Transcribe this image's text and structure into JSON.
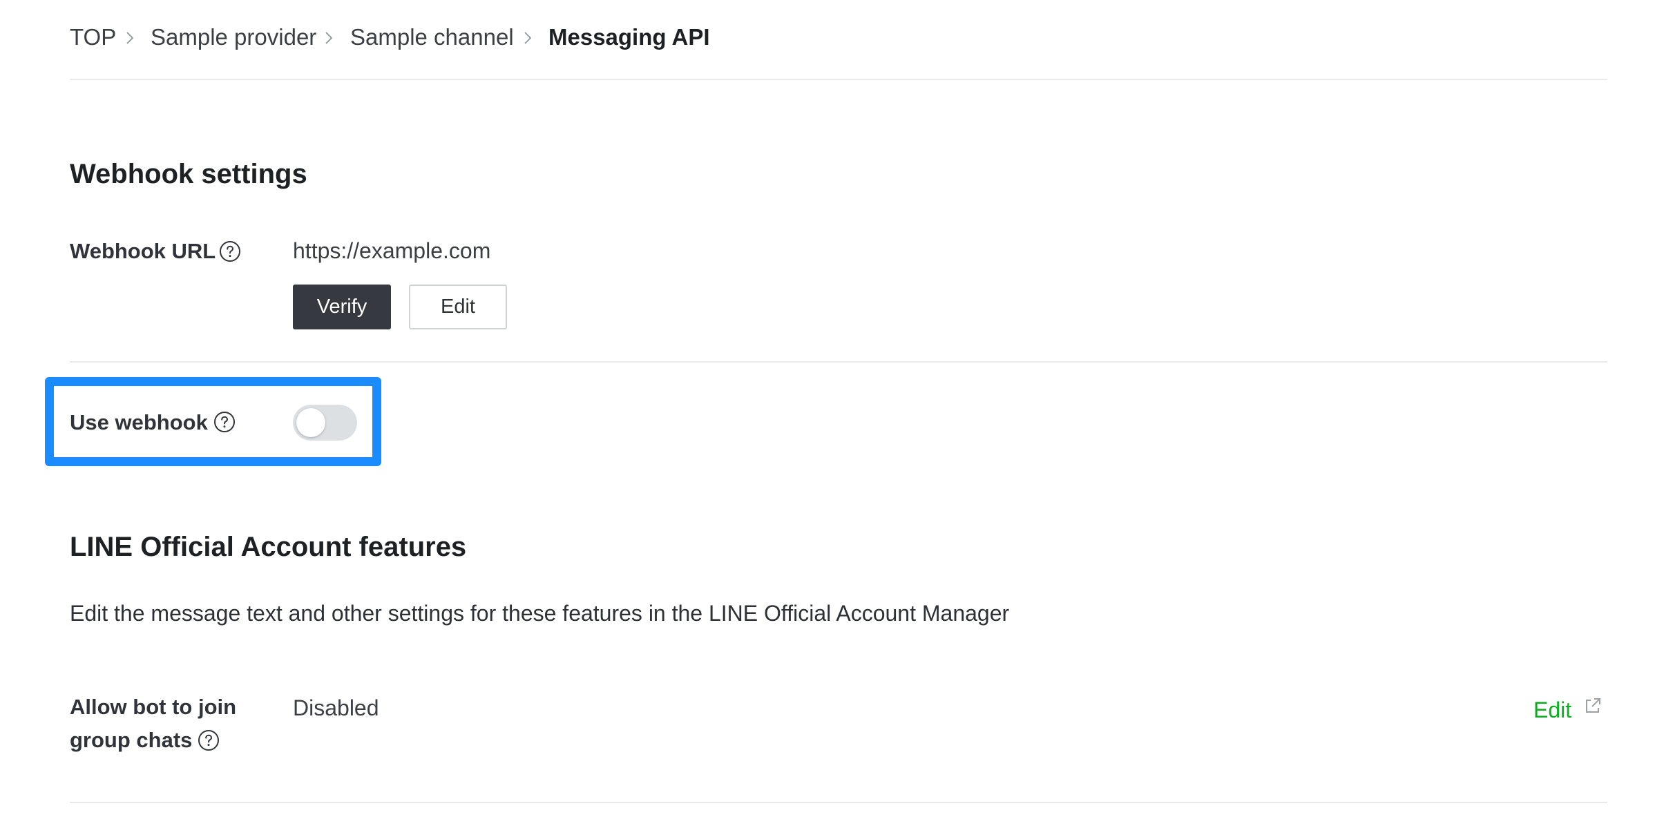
{
  "breadcrumb": {
    "items": [
      "TOP",
      "Sample provider",
      "Sample channel"
    ],
    "current": "Messaging API"
  },
  "webhook_settings": {
    "title": "Webhook settings",
    "url_label": "Webhook URL",
    "url_value": "https://example.com",
    "verify_label": "Verify",
    "edit_label": "Edit",
    "use_webhook_label": "Use webhook",
    "use_webhook_enabled": false
  },
  "official_account": {
    "title": "LINE Official Account features",
    "description": "Edit the message text and other settings for these features in the LINE Official Account Manager",
    "group_chat_label_line1": "Allow bot to join",
    "group_chat_label_line2": "group chats",
    "group_chat_value": "Disabled",
    "edit_link_label": "Edit"
  },
  "colors": {
    "highlight": "#1a8cff",
    "link_green": "#06b31c",
    "primary_button": "#363a40",
    "toggle_off": "#dde0e3"
  }
}
